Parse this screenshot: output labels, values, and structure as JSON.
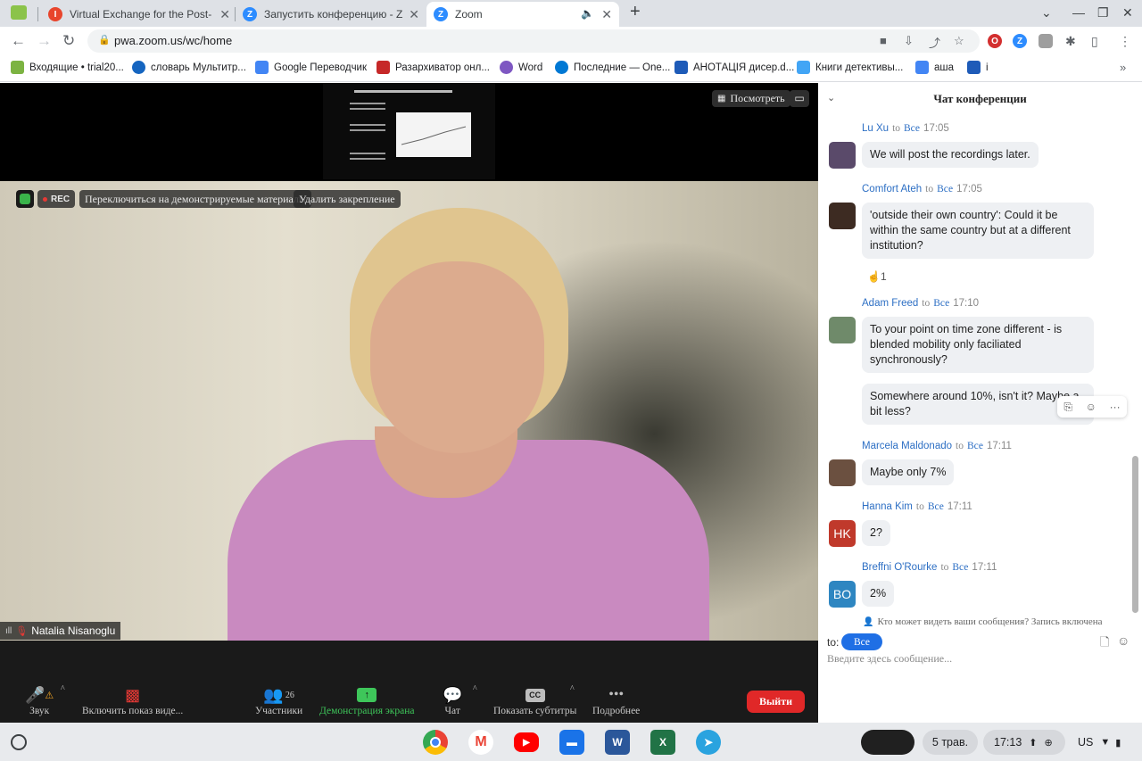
{
  "browser": {
    "tabs": [
      {
        "title": "Virtual Exchange for the Post-Pa",
        "favicon_color": "#e8452c",
        "active": false
      },
      {
        "title": "Запустить конференцию - Zoom",
        "favicon_color": "#2d8cff",
        "active": false
      },
      {
        "title": "Zoom",
        "favicon_color": "#2d8cff",
        "active": true
      }
    ],
    "url": "pwa.zoom.us/wc/home",
    "bookmarks": [
      {
        "label": "Входящие • trial20...",
        "color": "#7cb342"
      },
      {
        "label": "словарь Мультитр...",
        "color": "#1565c0"
      },
      {
        "label": "Google Переводчик",
        "color": "#4285f4"
      },
      {
        "label": "Разархиватор онл...",
        "color": "#c62828"
      },
      {
        "label": "Word",
        "color": "#7e57c2"
      },
      {
        "label": "Последние — One...",
        "color": "#0078d4"
      },
      {
        "label": "АНОТАЦІЯ дисер.d...",
        "color": "#1e5bb8"
      },
      {
        "label": "Книги детективы...",
        "color": "#42a5f5"
      },
      {
        "label": "аша",
        "color": "#4285f4"
      },
      {
        "label": "і",
        "color": "#1e5bb8"
      }
    ]
  },
  "meeting": {
    "view_button": "Посмотреть",
    "rec_label": "REC",
    "switch_button": "Переключиться на демонстрируемые материалы",
    "unpin_button": "Удалить закрепление",
    "participant_name": "Natalia Nisanoglu",
    "toolbar": {
      "audio": "Звук",
      "video": "Включить показ виде...",
      "participants": "Участники",
      "participants_count": "26",
      "share": "Демонстрация экрана",
      "chat": "Чат",
      "captions": "Показать субтитры",
      "captions_icon": "CC",
      "more": "Подробнее",
      "leave": "Выйти"
    }
  },
  "chat": {
    "title": "Чат конференции",
    "to_word": "to",
    "everyone": "Все",
    "messages": [
      {
        "sender": "Lu Xu",
        "time": "17:05",
        "text": "We will post the recordings later.",
        "avatar_color": "#5a4a6a"
      },
      {
        "sender": "Comfort Ateh",
        "time": "17:05",
        "text": "'outside their own country': Could it be within the same country but at a different institution?",
        "avatar_color": "#3d2b22",
        "reaction": "☝",
        "reaction_count": "1"
      },
      {
        "sender": "Adam Freed",
        "time": "17:10",
        "text": "To your point on time zone different - is blended mobility only faciliated synchronously?",
        "avatar_color": "#6f8a6a",
        "followup": "Somewhere around 10%, isn't it? Maybe a bit less?"
      },
      {
        "sender": "Marcela Maldonado",
        "time": "17:11",
        "text": "Maybe only 7%",
        "avatar_color": "#6b5040"
      },
      {
        "sender": "Hanna Kim",
        "time": "17:11",
        "text": "2?",
        "initials": "HK",
        "avatar_color": "#c0392b"
      },
      {
        "sender": "Breffni O'Rourke",
        "time": "17:11",
        "text": "2%",
        "initials": "BO",
        "avatar_color": "#2e86c1"
      }
    ],
    "notice": "Кто может видеть ваши сообщения? Запись включена",
    "to_label": "to:",
    "recipient": "Все",
    "input_placeholder": "Введите здесь сообщение..."
  },
  "shelf": {
    "date": "5 трав.",
    "time": "17:13",
    "lang": "US"
  }
}
